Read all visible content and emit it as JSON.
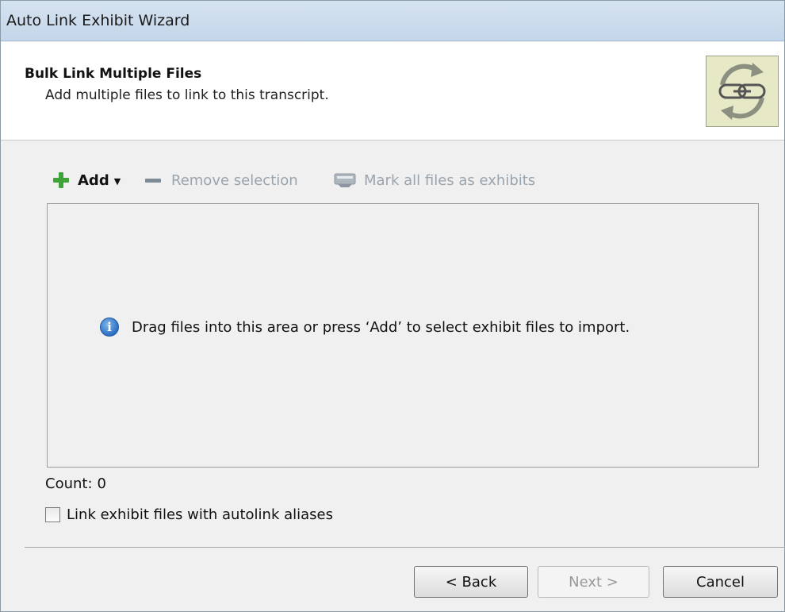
{
  "window": {
    "title": "Auto Link Exhibit Wizard"
  },
  "header": {
    "title": "Bulk Link Multiple Files",
    "subtitle": "Add multiple files to link to this transcript.",
    "logo_icon": "chain-link-refresh-icon"
  },
  "toolbar": {
    "add_label": "Add",
    "remove_label": "Remove selection",
    "mark_label": "Mark all files as exhibits",
    "colors": {
      "add_icon": "#3ea43a",
      "disabled_text": "#9aa4ad"
    }
  },
  "dropzone": {
    "message": "Drag files into this area or press ‘Add’ to select exhibit files to import.",
    "icon": "info-icon"
  },
  "count": {
    "label": "Count:",
    "value": "0"
  },
  "options": {
    "autolink_label": "Link exhibit files with autolink aliases",
    "autolink_checked": false
  },
  "buttons": {
    "back": "< Back",
    "next": "Next >",
    "cancel": "Cancel"
  }
}
